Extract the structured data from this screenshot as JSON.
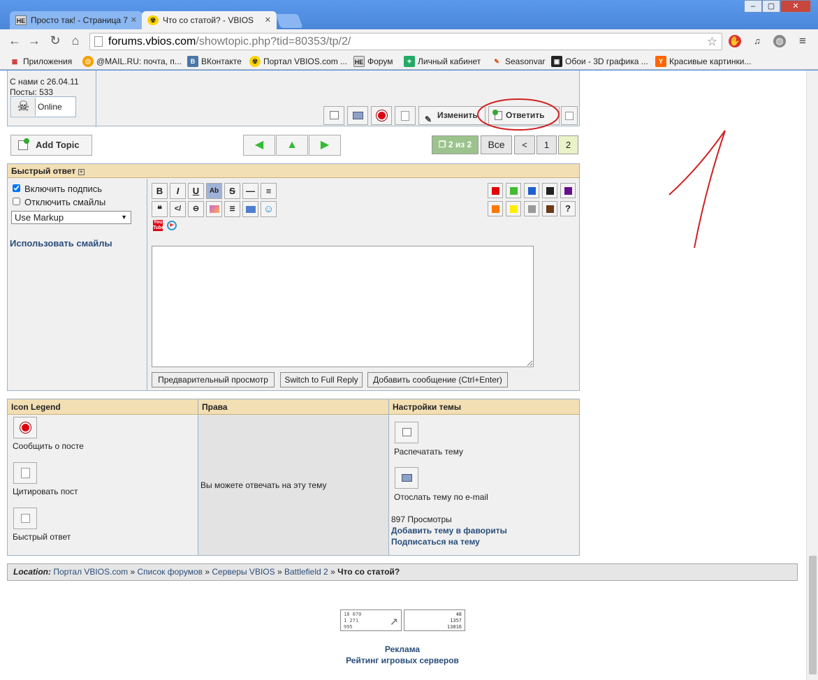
{
  "browser": {
    "tabs": [
      {
        "label": "Просто так! - Страница 7",
        "favicon": "HE"
      },
      {
        "label": "Что со статой? - VBIOS",
        "favicon": "☢"
      }
    ],
    "url_host": "forums.vbios.com",
    "url_path": "/showtopic.php?tid=80353/tp/2/",
    "bookmarks": [
      {
        "label": "Приложения",
        "icon": "▦"
      },
      {
        "label": "@MAIL.RU: почта, п...",
        "icon": "@"
      },
      {
        "label": "ВКонтакте",
        "icon": "B"
      },
      {
        "label": "Портал VBIOS.com ...",
        "icon": "☢"
      },
      {
        "label": "Форум",
        "icon": "HE"
      },
      {
        "label": "Личный кабинет",
        "icon": "✦"
      },
      {
        "label": "Seasonvar",
        "icon": "✎"
      },
      {
        "label": "Обои - 3D графика ...",
        "icon": "▣"
      },
      {
        "label": "Красивые картинки...",
        "icon": "Y"
      }
    ]
  },
  "post": {
    "member_since": "С нами с 26.04.11",
    "posts": "Посты: 533",
    "status": "Online",
    "edit_label": "Изменить",
    "reply_label": "Ответить"
  },
  "topic_controls": {
    "add_topic": "Add Topic",
    "page_info": "2 из 2",
    "pages": [
      "Все",
      "<",
      "1",
      "2"
    ]
  },
  "quick_reply": {
    "header": "Быстрый ответ",
    "enable_signature": "Включить подпись",
    "disable_smilies": "Отключить смайлы",
    "markup_select": "Use Markup",
    "use_smilies": "Использовать смайлы",
    "editor_buttons": [
      "B",
      "I",
      "U",
      "Ab",
      "S",
      "—",
      "≡"
    ],
    "preview_btn": "Предварительный просмотр",
    "full_reply_btn": "Switch to Full Reply",
    "submit_btn": "Добавить сообщение (Ctrl+Enter)",
    "colors": [
      "#e00000",
      "#44bb33",
      "#1f5fd0",
      "#222222",
      "#66108a",
      "#ff7700",
      "#ffee00",
      "#999999",
      "#6a3a1a"
    ],
    "help": "?"
  },
  "legend": {
    "col1_header": "Icon Legend",
    "col2_header": "Права",
    "col3_header": "Настройки темы",
    "report": "Сообщить о посте",
    "quote": "Цитировать пост",
    "quick": "Быстрый ответ",
    "rights_text": "Вы можете отвечать на эту тему",
    "print_topic": "Распечатать тему",
    "email_topic": "Отослать тему по e-mail",
    "views": "897 Просмотры",
    "add_fav": "Добавить тему в фавориты",
    "subscribe": "Подписаться на тему"
  },
  "location": {
    "label": "Location:",
    "crumbs": [
      "Портал VBIOS.com",
      "Список форумов",
      "Серверы VBIOS",
      "Battlefield 2"
    ],
    "sep": "»",
    "current": "Что со статой?"
  },
  "footer": {
    "counter1": "18 070\n1 271\n995",
    "counter2": "48\n1357\n13816",
    "ads": "Реклама",
    "rating": "Рейтинг игровых серверов"
  }
}
